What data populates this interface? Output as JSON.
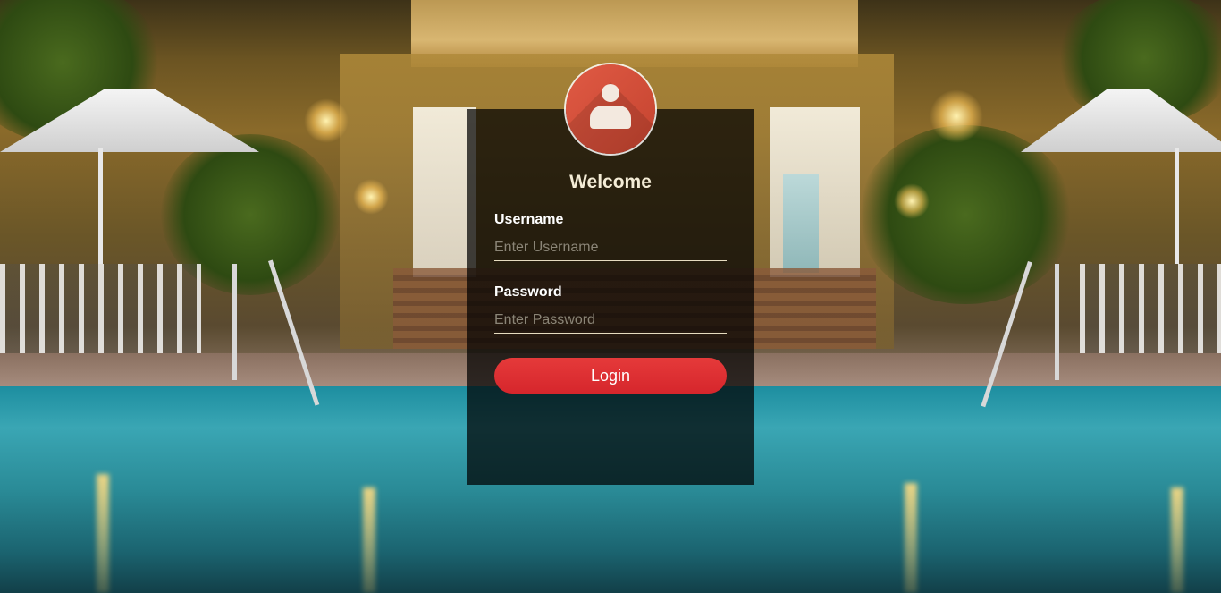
{
  "login": {
    "welcome": "Welcome",
    "username": {
      "label": "Username",
      "placeholder": "Enter Username",
      "value": ""
    },
    "password": {
      "label": "Password",
      "placeholder": "Enter Password",
      "value": ""
    },
    "submit_label": "Login",
    "avatar_icon": "user-icon"
  },
  "colors": {
    "card_background": "rgba(0,0,0,0.72)",
    "avatar_accent": "#e05a44",
    "button_accent": "#e0312f",
    "welcome_text": "#f4ecd6",
    "input_underline": "#e6dcc0"
  }
}
